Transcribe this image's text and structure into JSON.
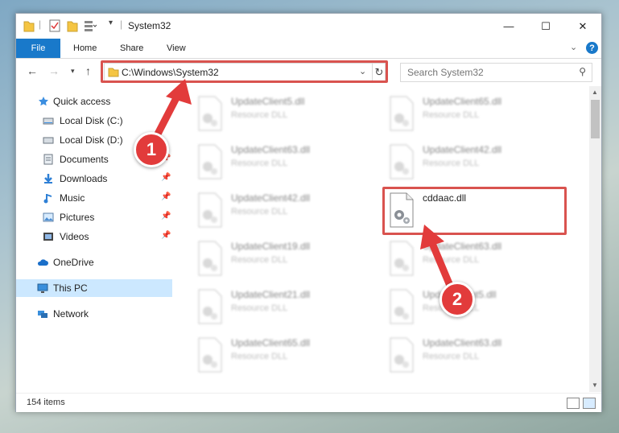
{
  "window": {
    "title": "System32",
    "controls": {
      "minimize": "—",
      "maximize": "☐",
      "close": "✕"
    }
  },
  "ribbon": {
    "tabs": [
      "File",
      "Home",
      "Share",
      "View"
    ],
    "help": "?"
  },
  "nav": {
    "address": "C:\\Windows\\System32",
    "search_placeholder": "Search System32"
  },
  "sidebar": {
    "items": [
      {
        "label": "Quick access",
        "icon": "star-icon"
      },
      {
        "label": "Local Disk (C:)",
        "icon": "drive-icon"
      },
      {
        "label": "Local Disk (D:)",
        "icon": "drive-icon"
      },
      {
        "label": "Documents",
        "icon": "documents-icon"
      },
      {
        "label": "Downloads",
        "icon": "download-icon"
      },
      {
        "label": "Music",
        "icon": "music-icon"
      },
      {
        "label": "Pictures",
        "icon": "pictures-icon"
      },
      {
        "label": "Videos",
        "icon": "videos-icon"
      },
      {
        "label": "OneDrive",
        "icon": "cloud-icon"
      },
      {
        "label": "This PC",
        "icon": "computer-icon"
      },
      {
        "label": "Network",
        "icon": "network-icon"
      }
    ]
  },
  "files": [
    {
      "name": "UpdateClient5.dll",
      "type": "Resource DLL"
    },
    {
      "name": "UpdateClient65.dll",
      "type": "Resource DLL"
    },
    {
      "name": "UpdateClient63.dll",
      "type": "Resource DLL"
    },
    {
      "name": "UpdateClient42.dll",
      "type": "Resource DLL"
    },
    {
      "name": "UpdateClient42.dll",
      "type": "Resource DLL"
    },
    {
      "name": "cddaac.dll",
      "type": ""
    },
    {
      "name": "UpdateClient19.dll",
      "type": "Resource DLL"
    },
    {
      "name": "UpdateClient63.dll",
      "type": "Resource DLL"
    },
    {
      "name": "UpdateClient21.dll",
      "type": "Resource DLL"
    },
    {
      "name": "UpdateClient5.dll",
      "type": "Resource DLL"
    },
    {
      "name": "UpdateClient65.dll",
      "type": "Resource DLL"
    },
    {
      "name": "UpdateClient63.dll",
      "type": "Resource DLL"
    }
  ],
  "status": {
    "items_count": "154 items"
  },
  "steps": {
    "one": "1",
    "two": "2"
  },
  "colors": {
    "accent": "#1979ca",
    "highlight": "#d9534f",
    "selection": "#cce8ff"
  }
}
